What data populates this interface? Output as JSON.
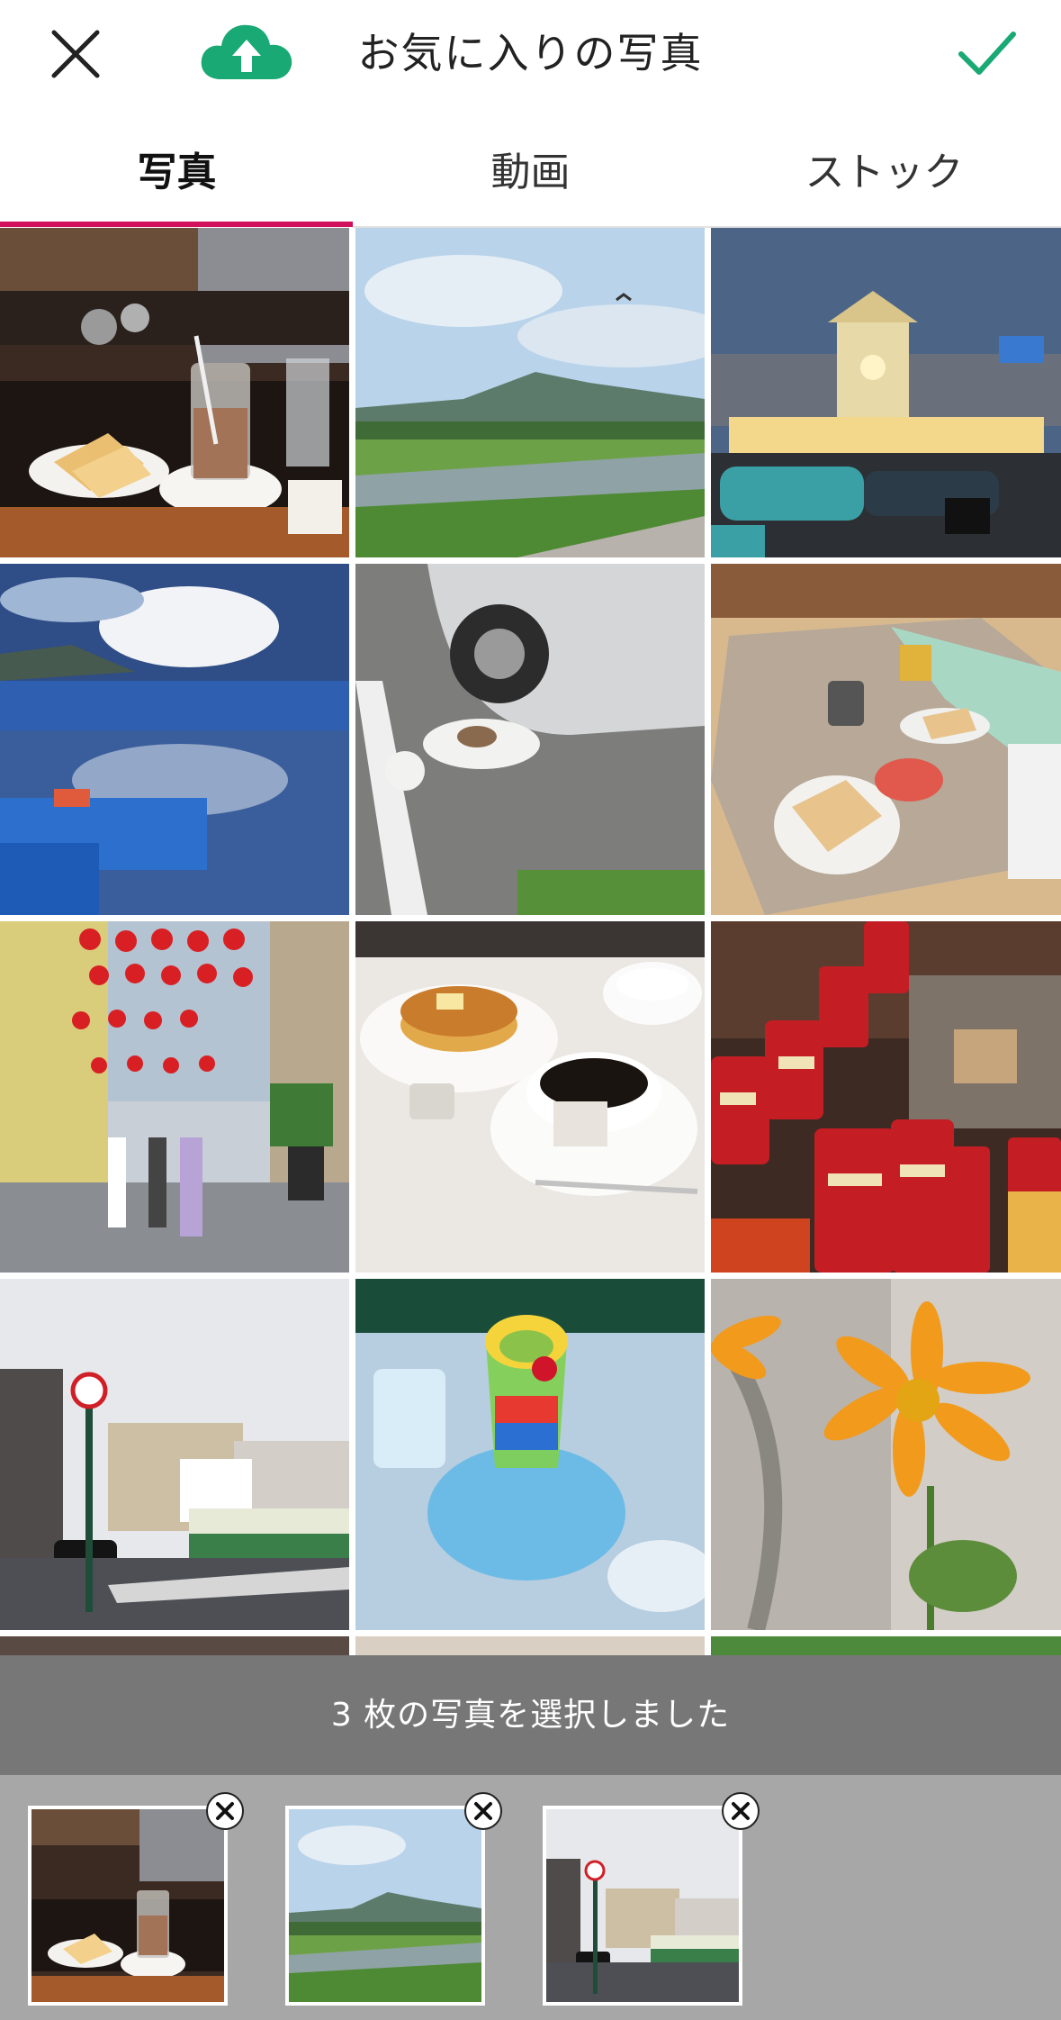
{
  "header": {
    "title": "お気に入りの写真",
    "close_icon": "close-icon",
    "upload_icon": "cloud-upload-icon",
    "confirm_icon": "checkmark-icon",
    "accent_color": "#19a974"
  },
  "tabs": [
    {
      "label": "写真",
      "active": true
    },
    {
      "label": "動画",
      "active": false
    },
    {
      "label": "ストック",
      "active": false
    }
  ],
  "tab_indicator_color": "#d0105a",
  "photos": [
    {
      "subject": "cafe-counter-toast-iced-coffee",
      "selected": true
    },
    {
      "subject": "river-and-mountains",
      "selected": true
    },
    {
      "subject": "night-market-clock-tower",
      "selected": false
    },
    {
      "subject": "harbor-boats-reflection",
      "selected": false
    },
    {
      "subject": "cat-beside-car",
      "selected": false
    },
    {
      "subject": "breakfast-table-toast",
      "selected": false
    },
    {
      "subject": "street-red-lanterns",
      "selected": false
    },
    {
      "subject": "pancakes-and-coffee",
      "selected": false
    },
    {
      "subject": "red-coffee-tins",
      "selected": false
    },
    {
      "subject": "street-with-bus",
      "selected": true
    },
    {
      "subject": "fruit-jelly-glass",
      "selected": false
    },
    {
      "subject": "orange-cosmos-flower",
      "selected": false
    }
  ],
  "selection": {
    "message": "3 枚の写真を選択しました",
    "count": 3,
    "remove_icon": "remove-icon"
  }
}
